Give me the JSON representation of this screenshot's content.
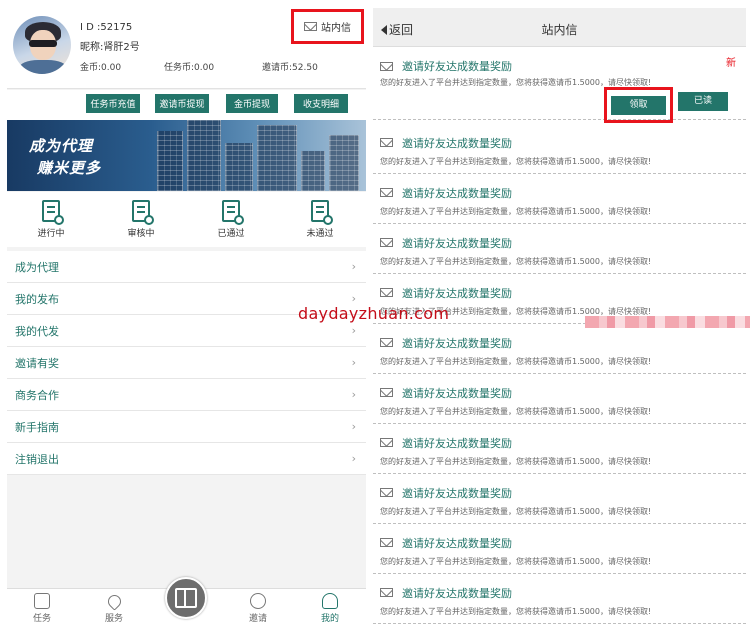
{
  "left": {
    "profile": {
      "id_text": "I D :52175",
      "nickname": "昵称:肾肝2号",
      "coins": [
        {
          "label": "金币:0.00"
        },
        {
          "label": "任务币:0.00"
        },
        {
          "label": "邀请币:52.50"
        }
      ],
      "message_button": "站内信"
    },
    "actions": [
      "任务币充值",
      "邀请币提现",
      "金币提现",
      "收支明细"
    ],
    "banner": {
      "line1": "成为代理",
      "line2": "赚米更多"
    },
    "statuses": [
      {
        "label": "进行中",
        "icon": "doc-clock-icon"
      },
      {
        "label": "审核中",
        "icon": "doc-search-icon"
      },
      {
        "label": "已通过",
        "icon": "doc-check-icon"
      },
      {
        "label": "未通过",
        "icon": "doc-cross-icon"
      }
    ],
    "menu": [
      "成为代理",
      "我的发布",
      "我的代发",
      "邀请有奖",
      "商务合作",
      "新手指南",
      "注销退出"
    ],
    "menu_arrow": "›",
    "tabs": [
      {
        "label": "任务",
        "icon": "task-icon"
      },
      {
        "label": "服务",
        "icon": "heart-icon"
      },
      {
        "label": "",
        "icon": "gift-icon"
      },
      {
        "label": "邀请",
        "icon": "share-icon"
      },
      {
        "label": "我的",
        "icon": "user-icon"
      }
    ]
  },
  "right": {
    "nav": {
      "back": "返回",
      "title": "站内信"
    },
    "messages": [
      {
        "title": "邀请好友达成数量奖励",
        "body": "您的好友进入了平台并达到指定数量，您将获得邀请币1.5000，请尽快领取!",
        "new": "新",
        "claim": "领取",
        "read": "已读"
      },
      {
        "title": "邀请好友达成数量奖励",
        "body": "您的好友进入了平台并达到指定数量，您将获得邀请币1.5000，请尽快领取!"
      },
      {
        "title": "邀请好友达成数量奖励",
        "body": "您的好友进入了平台并达到指定数量，您将获得邀请币1.5000，请尽快领取!"
      },
      {
        "title": "邀请好友达成数量奖励",
        "body": "您的好友进入了平台并达到指定数量，您将获得邀请币1.5000，请尽快领取!"
      },
      {
        "title": "邀请好友达成数量奖励",
        "body": "您的好友进入了平台并达到指定数量，您将获得邀请币1.5000，请尽快领取!"
      },
      {
        "title": "邀请好友达成数量奖励",
        "body": "您的好友进入了平台并达到指定数量，您将获得邀请币1.5000，请尽快领取!"
      },
      {
        "title": "邀请好友达成数量奖励",
        "body": "您的好友进入了平台并达到指定数量，您将获得邀请币1.5000，请尽快领取!"
      },
      {
        "title": "邀请好友达成数量奖励",
        "body": "您的好友进入了平台并达到指定数量，您将获得邀请币1.5000，请尽快领取!"
      },
      {
        "title": "邀请好友达成数量奖励",
        "body": "您的好友进入了平台并达到指定数量，您将获得邀请币1.5000，请尽快领取!"
      },
      {
        "title": "邀请好友达成数量奖励",
        "body": "您的好友进入了平台并达到指定数量，您将获得邀请币1.5000，请尽快领取!"
      },
      {
        "title": "邀请好友达成数量奖励",
        "body": "您的好友进入了平台并达到指定数量，您将获得邀请币1.5000，请尽快领取!"
      }
    ]
  },
  "watermark": "daydayzhuan.com",
  "colors": {
    "accent": "#23756a",
    "highlight": "#e8141d",
    "new_tag": "#e8141d"
  }
}
